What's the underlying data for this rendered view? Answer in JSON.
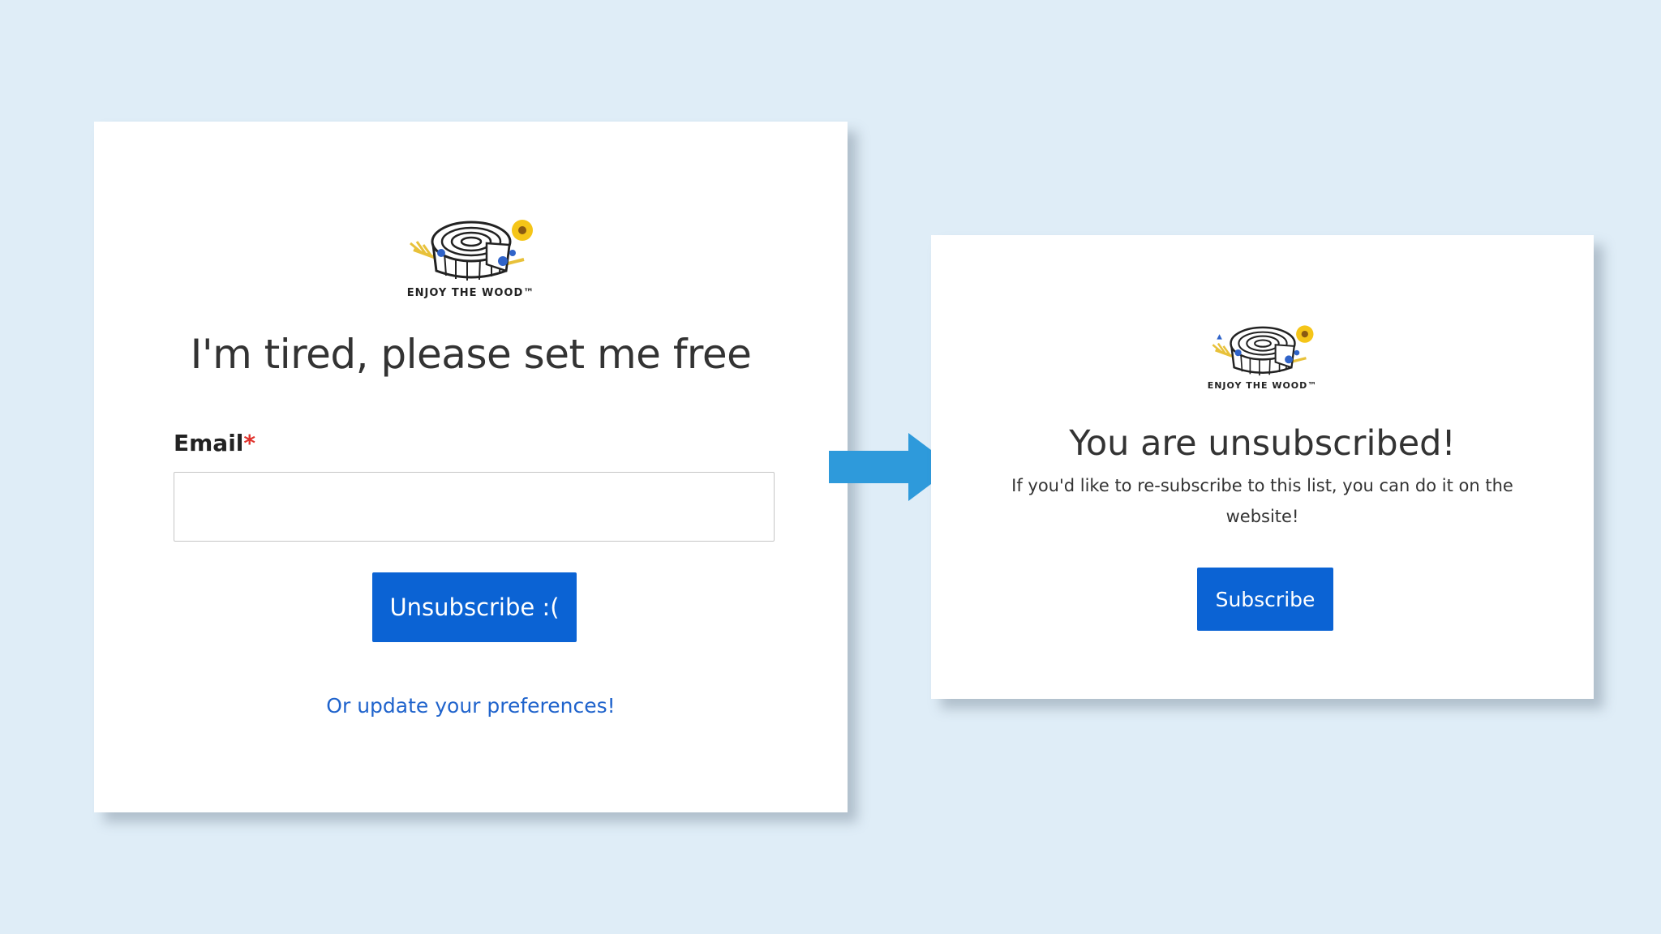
{
  "colors": {
    "page_background": "#dfedf7",
    "card_background": "#ffffff",
    "primary_button": "#0b63d4",
    "link": "#1f63cc",
    "required_star": "#e0322c",
    "arrow": "#2e9adb"
  },
  "left_panel": {
    "logo": {
      "icon": "wood-stump-sunflower-logo",
      "text": "ENJOY THE WOOD™"
    },
    "heading": "I'm tired, please set me free",
    "email_label": "Email",
    "required_marker": "*",
    "email_value": "",
    "email_placeholder": "",
    "unsubscribe_label": "Unsubscribe :(",
    "preferences_link": "Or update your preferences!"
  },
  "arrow": {
    "icon": "right-arrow-icon"
  },
  "right_panel": {
    "logo": {
      "icon": "wood-stump-sunflower-logo",
      "text": "ENJOY THE WOOD™"
    },
    "heading": "You are unsubscribed!",
    "message": "If you'd like to re-subscribe to this list, you can do it on the website!",
    "subscribe_label": "Subscribe"
  }
}
